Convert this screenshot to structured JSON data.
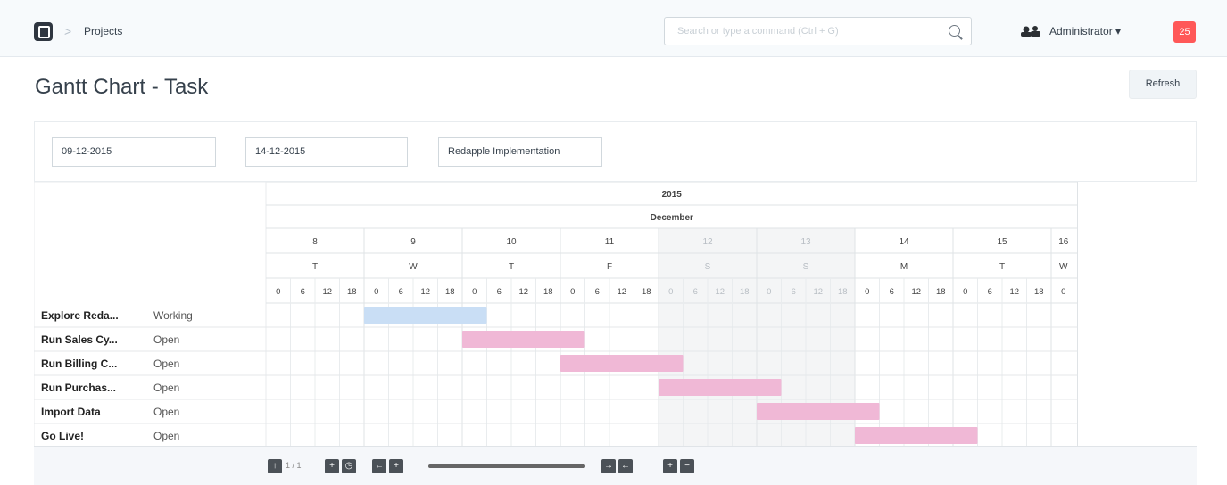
{
  "navbar": {
    "breadcrumb": "Projects",
    "search_placeholder": "Search or type a command (Ctrl + G)",
    "user_name": "Administrator ▾",
    "notification_count": "25"
  },
  "page": {
    "title": "Gantt Chart - Task",
    "refresh_label": "Refresh"
  },
  "filters": {
    "from_date": "09-12-2015",
    "to_date": "14-12-2015",
    "project": "Redapple Implementation"
  },
  "chart_data": {
    "type": "gantt",
    "year": "2015",
    "month": "December",
    "days": [
      {
        "date": "8",
        "weekday": "T",
        "weekend": false
      },
      {
        "date": "9",
        "weekday": "W",
        "weekend": false
      },
      {
        "date": "10",
        "weekday": "T",
        "weekend": false
      },
      {
        "date": "11",
        "weekday": "F",
        "weekend": false
      },
      {
        "date": "12",
        "weekday": "S",
        "weekend": true
      },
      {
        "date": "13",
        "weekday": "S",
        "weekend": true
      },
      {
        "date": "14",
        "weekday": "M",
        "weekend": false
      },
      {
        "date": "15",
        "weekday": "T",
        "weekend": false
      },
      {
        "date": "16",
        "weekday": "W",
        "weekend": false
      }
    ],
    "hours": [
      "0",
      "6",
      "12",
      "18"
    ],
    "tasks": [
      {
        "name": "Explore Reda...",
        "status": "Working",
        "start": "2015-12-09",
        "end": "2015-12-10 06:00",
        "color": "#c9def5"
      },
      {
        "name": "Run Sales Cy...",
        "status": "Open",
        "start": "2015-12-10",
        "end": "2015-12-11 06:00",
        "color": "#f0b8d6"
      },
      {
        "name": "Run Billing C...",
        "status": "Open",
        "start": "2015-12-11",
        "end": "2015-12-12 06:00",
        "color": "#f0b8d6"
      },
      {
        "name": "Run Purchas...",
        "status": "Open",
        "start": "2015-12-12",
        "end": "2015-12-13 06:00",
        "color": "#f0b8d6"
      },
      {
        "name": "Import Data",
        "status": "Open",
        "start": "2015-12-13",
        "end": "2015-12-14 06:00",
        "color": "#f0b8d6"
      },
      {
        "name": "Go Live!",
        "status": "Open",
        "start": "2015-12-14",
        "end": "2015-12-15 06:00",
        "color": "#f0b8d6"
      }
    ]
  },
  "controls": {
    "page_indicator": "1 / 1",
    "icons": [
      "expand-icon",
      "add-icon",
      "clock-icon",
      "prev-icon",
      "next-icon",
      "collapse-left-icon",
      "collapse-right-icon",
      "zoom-in-icon",
      "zoom-out-icon"
    ]
  }
}
